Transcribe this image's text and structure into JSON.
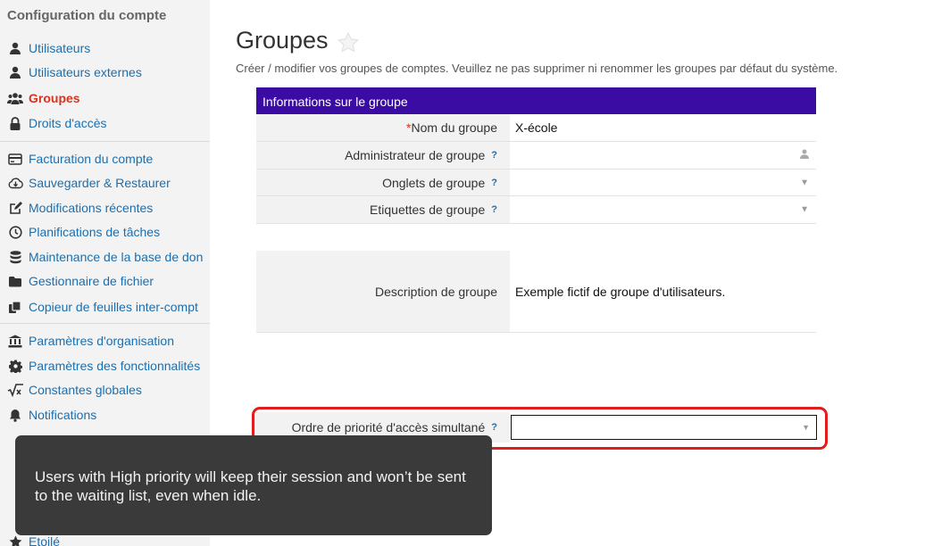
{
  "sidebar": {
    "title": "Configuration du compte",
    "items": [
      {
        "label": "Utilisateurs",
        "icon": "user-icon"
      },
      {
        "label": "Utilisateurs externes",
        "icon": "user-icon"
      },
      {
        "label": "Groupes",
        "icon": "users-group-icon",
        "active": true
      },
      {
        "label": "Droits d'accès",
        "icon": "lock-icon"
      },
      {
        "label": "Facturation du compte",
        "icon": "credit-card-icon"
      },
      {
        "label": "Sauvegarder & Restaurer",
        "icon": "cloud-download-icon"
      },
      {
        "label": "Modifications récentes",
        "icon": "edit-icon"
      },
      {
        "label": "Planifications de tâches",
        "icon": "clock-icon"
      },
      {
        "label": "Maintenance de la base de don",
        "icon": "database-icon"
      },
      {
        "label": "Gestionnaire de fichier",
        "icon": "folder-icon"
      },
      {
        "label": "Copieur de feuilles inter-compt",
        "icon": "copy-icon"
      },
      {
        "label": "Paramètres d'organisation",
        "icon": "bank-icon"
      },
      {
        "label": "Paramètres des fonctionnalités",
        "icon": "cog-icon"
      },
      {
        "label": "Constantes globales",
        "icon": "sqrt-icon"
      },
      {
        "label": "Notifications",
        "icon": "bell-icon"
      },
      {
        "label": "Etoilé",
        "icon": "star-icon"
      }
    ]
  },
  "page": {
    "title": "Groupes",
    "subtitle": "Créer / modifier vos groupes de comptes. Veuillez ne pas supprimer ni renommer les groupes par défaut du système."
  },
  "form": {
    "header": "Informations sur le groupe",
    "required_mark": "*",
    "help_mark": "?",
    "fields": {
      "name": {
        "label": "Nom du groupe",
        "value": "X-école"
      },
      "admin": {
        "label": "Administrateur de groupe",
        "value": ""
      },
      "tabs": {
        "label": "Onglets de groupe",
        "value": ""
      },
      "tags": {
        "label": "Etiquettes de groupe",
        "value": ""
      },
      "description": {
        "label": "Description de groupe",
        "value": "Exemple fictif de groupe d'utilisateurs."
      },
      "priority": {
        "label": "Ordre de priorité d'accès simultané",
        "value": ""
      }
    }
  },
  "tooltip": {
    "text": "Users with High priority will keep their session and won’t be sent to the waiting list, even when idle."
  },
  "colors": {
    "panel_header": "#3a0ca3",
    "active_nav": "#d9321f",
    "link": "#1a6fb0",
    "highlight": "#e31c1c"
  }
}
